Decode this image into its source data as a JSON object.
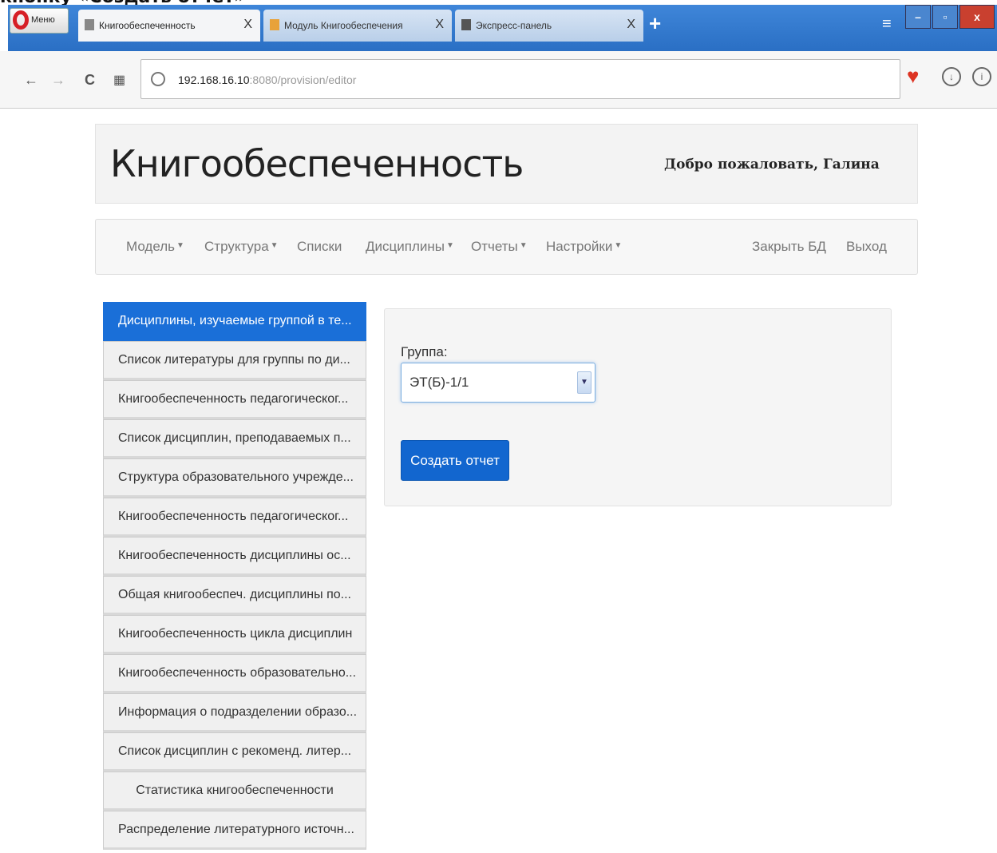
{
  "caption": "кнопку «Создать отчет»",
  "browser": {
    "menu_label": "Меню",
    "tabs": [
      {
        "label": "Книгообеспеченность",
        "close": "X"
      },
      {
        "label": "Модуль Книгообеспечения",
        "close": "X"
      },
      {
        "label": "Экспресс-панель",
        "close": "X"
      }
    ],
    "new_tab": "+",
    "url_host": "192.168.16.10",
    "url_path": ":8080/provision/editor"
  },
  "app": {
    "title": "Книгообеспеченность",
    "welcome": "Добро пожаловать, Галина"
  },
  "nav": {
    "left": [
      "Модель",
      "Структура",
      "Списки",
      "Дисциплины",
      "Отчеты",
      "Настройки"
    ],
    "right": [
      "Закрыть БД",
      "Выход"
    ]
  },
  "sidebar": {
    "items": [
      "Дисциплины, изучаемые группой в те...",
      "Список литературы для группы по ди...",
      "Книгообеспеченность педагогическог...",
      "Список дисциплин, преподаваемых п...",
      "Структура образовательного учрежде...",
      "Книгообеспеченность педагогическог...",
      "Книгообеспеченность дисциплины ос...",
      "Общая книгообеспеч. дисциплины по...",
      "Книгообеспеченность цикла дисциплин",
      "Книгообеспеченность образовательно...",
      "Информация о подразделении образо...",
      "Список дисциплин с рекоменд. литер...",
      "Статистика книгообеспеченности",
      "Распределение литературного источн..."
    ]
  },
  "form": {
    "group_label": "Группа:",
    "group_value": "ЭТ(Б)-1/1",
    "submit_label": "Создать отчет"
  },
  "colors": {
    "accent": "#1266cf",
    "tab_strip": "#2a6fc4"
  }
}
